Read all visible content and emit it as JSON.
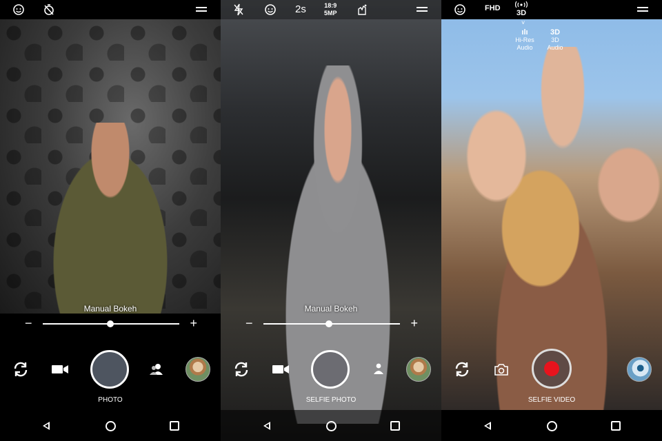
{
  "screens": [
    {
      "top": {
        "icons": [
          "face-beauty-icon",
          "timer-off-icon",
          "menu-icon"
        ]
      },
      "overlay_label": "Manual Bokeh",
      "slider": {
        "minus": "−",
        "plus": "+",
        "value": 0.42
      },
      "mode_label": "PHOTO",
      "controls": [
        "switch-camera-icon",
        "video-camera-icon",
        "shutter",
        "people-icon",
        "gallery-thumbnail"
      ]
    },
    {
      "top": {
        "icons": [
          "flash-off-icon",
          "face-beauty-icon",
          "ratio-icon",
          "gesture-icon",
          "menu-icon"
        ],
        "timer": "2s",
        "ratio": "18:9",
        "resolution": "5MP"
      },
      "overlay_label": "Manual Bokeh",
      "slider": {
        "minus": "−",
        "plus": "+",
        "value": 0.5
      },
      "mode_label": "SELFIE PHOTO",
      "controls": [
        "switch-camera-icon",
        "video-camera-icon",
        "shutter",
        "person-icon",
        "gallery-thumbnail"
      ]
    },
    {
      "top": {
        "icons": [
          "face-beauty-icon",
          "broadcast-icon",
          "menu-icon"
        ],
        "quality": "FHD",
        "audio": "3D"
      },
      "audio_menu": {
        "items": [
          {
            "icon_label": "ılı",
            "label": "Hi-Res Audio"
          },
          {
            "icon_label": "3D",
            "label": "3D Audio"
          }
        ],
        "chevron": "˅"
      },
      "mode_label": "SELFIE VIDEO",
      "controls": [
        "switch-camera-icon",
        "photo-camera-icon",
        "record-button",
        "gallery-thumbnail"
      ]
    }
  ],
  "colors": {
    "record": "#e8131d",
    "shutter_fill": "#4e5560"
  }
}
